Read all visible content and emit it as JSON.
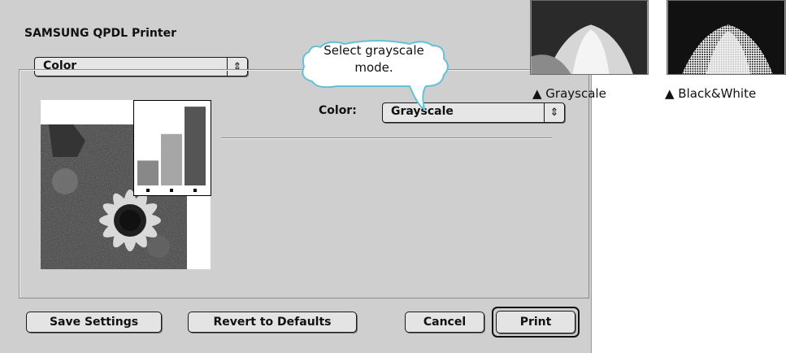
{
  "dialog": {
    "title": "SAMSUNG QPDL Printer",
    "panel_menu": {
      "selected": "Color"
    },
    "color_field": {
      "label": "Color:",
      "selected": "Grayscale"
    },
    "buttons": {
      "save_settings": "Save Settings",
      "revert_defaults": "Revert to Defaults",
      "cancel": "Cancel",
      "print": "Print"
    },
    "arrows_glyph": "⇕"
  },
  "callout": {
    "line1": "Select grayscale",
    "line2": "mode."
  },
  "samples": [
    {
      "caption": "▲ Grayscale"
    },
    {
      "caption": "▲ Black&White"
    }
  ],
  "chart_data": {
    "type": "bar",
    "categories": [
      "",
      "",
      ""
    ],
    "values": [
      0.3,
      0.62,
      0.95
    ],
    "colors": [
      "#888888",
      "#a6a6a6",
      "#555555"
    ]
  }
}
